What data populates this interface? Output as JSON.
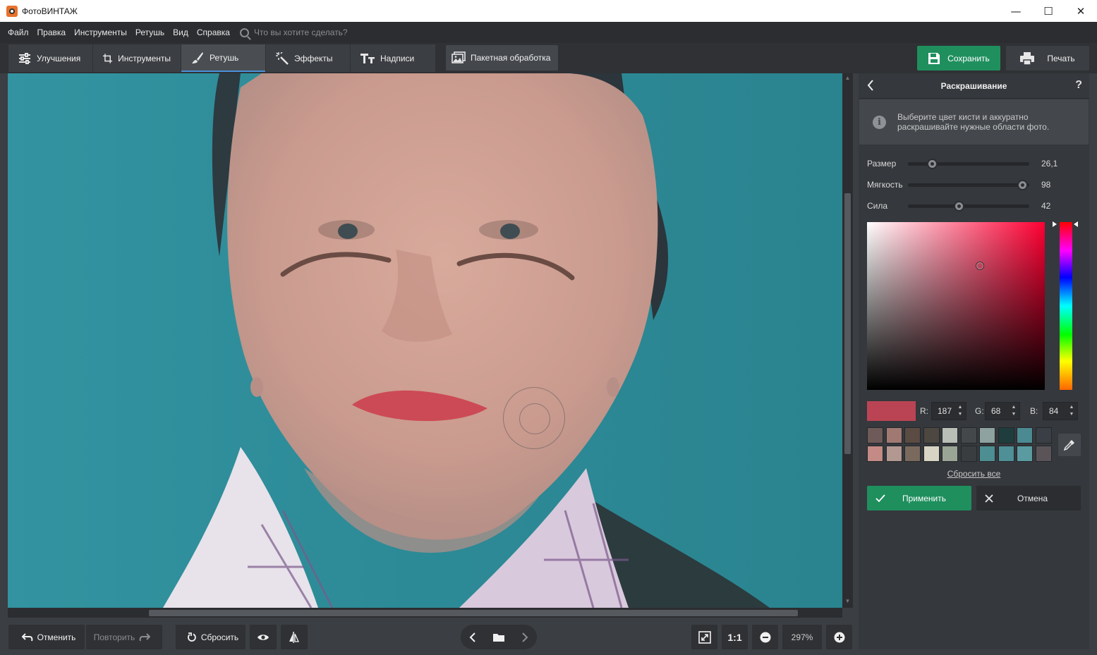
{
  "window": {
    "title": "ФотоВИНТАЖ",
    "minimize": "—",
    "maximize": "☐",
    "close": "✕"
  },
  "menu": {
    "items": [
      "Файл",
      "Правка",
      "Инструменты",
      "Ретушь",
      "Вид",
      "Справка"
    ],
    "search_placeholder": "Что вы хотите сделать?"
  },
  "tabs": [
    {
      "label": "Улучшения",
      "icon": "sliders-icon"
    },
    {
      "label": "Инструменты",
      "icon": "crop-icon"
    },
    {
      "label": "Ретушь",
      "icon": "brush-icon",
      "active": true
    },
    {
      "label": "Эффекты",
      "icon": "magic-wand-icon"
    },
    {
      "label": "Надписи",
      "icon": "text-icon"
    }
  ],
  "toolbar": {
    "batch_label": "Пакетная обработка",
    "save_label": "Сохранить",
    "print_label": "Печать"
  },
  "bottom": {
    "undo_label": "Отменить",
    "redo_label": "Повторить",
    "reset_label": "Сбросить",
    "fit_label": "1:1",
    "zoom": "297%"
  },
  "panel": {
    "title": "Раскрашивание",
    "help": "?",
    "info": "Выберите цвет кисти и аккуратно раскрашивайте нужные области фото.",
    "sliders": [
      {
        "label": "Размер",
        "value": "26,1",
        "fraction": 0.2
      },
      {
        "label": "Мягкость",
        "value": "98",
        "fraction": 0.94
      },
      {
        "label": "Сила",
        "value": "42",
        "fraction": 0.42
      }
    ],
    "color": {
      "hex": "#bb4454",
      "r": "187",
      "g": "68",
      "b": "84"
    },
    "labels": {
      "r": "R:",
      "g": "G:",
      "b": "B:"
    },
    "palette": [
      [
        "#6e5a58",
        "#a07a72",
        "#5a4b43",
        "#4d4741",
        "#b9bfb6",
        "#44484a",
        "#8ea2a0",
        "#1f3d3d",
        "#4c8a92",
        "#3a3f45"
      ],
      [
        "#c48b86",
        "#b39892",
        "#7a6a5e",
        "#d8d4c4",
        "#9aa596",
        "#3a3d3f",
        "#4d8e92",
        "#4f8f96",
        "#5a9ba2",
        "#5a5458"
      ]
    ],
    "reset_all": "Сбросить все",
    "apply_label": "Применить",
    "cancel_label": "Отмена"
  }
}
